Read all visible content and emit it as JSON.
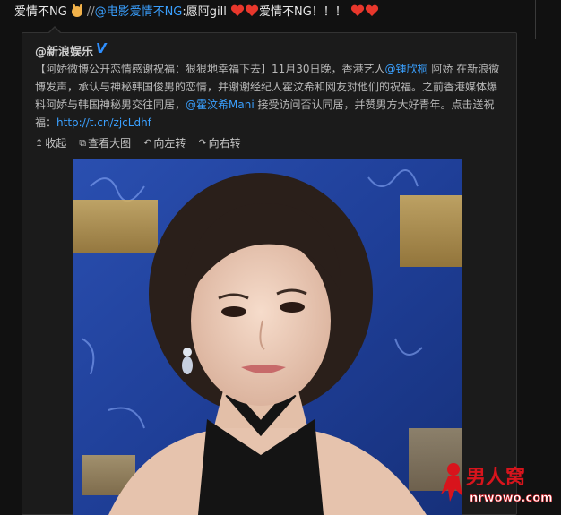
{
  "post": {
    "lead_text": "爱情不NG",
    "repost_prefix": "//",
    "mention": "@电影爱情不NG",
    "colon_text": ":愿阿gill",
    "tail_text": "爱情不NG！！！"
  },
  "card": {
    "author": "@新浪娱乐",
    "verified_mark": "V",
    "text_parts": [
      "【阿娇微博公开恋情感谢祝福：狠狠地幸福下去】11月30日晚，香港艺人",
      "@锺欣桐",
      " 阿娇 在新浪微博发声，承认与神秘韩国俊男的恋情，并谢谢经纪人霍汶希和网友对他们的祝福。之前香港媒体爆料阿娇与韩国神秘男交往同居，",
      "@霍汶希Mani",
      " 接受访问否认同居，并赞男方大好青年。点击送祝福：",
      "http://t.cn/zjcLdhf"
    ],
    "actions": [
      {
        "icon": "↥",
        "label": "收起"
      },
      {
        "icon": "⧉",
        "label": "查看大图"
      },
      {
        "icon": "↶",
        "label": "向左转"
      },
      {
        "icon": "↷",
        "label": "向右转"
      }
    ]
  },
  "watermark": {
    "cn": "男人窝",
    "url": "nrwowo.com"
  },
  "colors": {
    "link": "#3aa0ff",
    "heart": "#e8372c",
    "watermark": "#d8141c"
  }
}
